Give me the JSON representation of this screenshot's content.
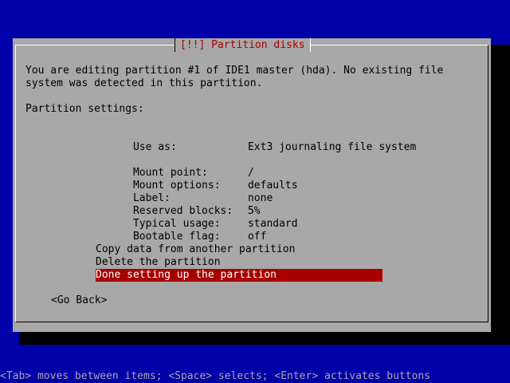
{
  "dialog": {
    "title": "[!!] Partition disks",
    "description_line1": "You are editing partition #1 of IDE1 master (hda). No existing file",
    "description_line2": "system was detected in this partition.",
    "settings_header": "Partition settings:"
  },
  "settings": [
    {
      "label": "Use as:",
      "value": "Ext3 journaling file system"
    },
    {
      "label": "Mount point:",
      "value": "/"
    },
    {
      "label": "Mount options:",
      "value": "defaults"
    },
    {
      "label": "Label:",
      "value": "none"
    },
    {
      "label": "Reserved blocks:",
      "value": "5%"
    },
    {
      "label": "Typical usage:",
      "value": "standard"
    },
    {
      "label": "Bootable flag:",
      "value": "off"
    }
  ],
  "actions": [
    {
      "label": "Copy data from another partition"
    },
    {
      "label": "Delete the partition"
    },
    {
      "label": "Done setting up the partition"
    }
  ],
  "go_back": "<Go Back>",
  "footer": "<Tab> moves between items; <Space> selects; <Enter> activates buttons",
  "colors": {
    "background": "#0000a8",
    "dialog": "#a8a8a8",
    "title_text": "#a80000",
    "selection": "#a80000",
    "selection_text": "#ffffff"
  }
}
